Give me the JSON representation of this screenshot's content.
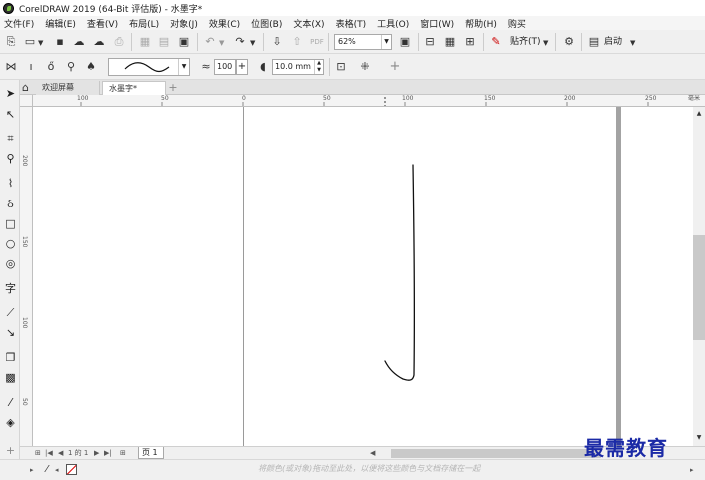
{
  "window": {
    "title": "CorelDRAW 2019 (64-Bit 评估版) - 水墨字*"
  },
  "menu": [
    "文件(F)",
    "编辑(E)",
    "查看(V)",
    "布局(L)",
    "对象(J)",
    "效果(C)",
    "位图(B)",
    "文本(X)",
    "表格(T)",
    "工具(O)",
    "窗口(W)",
    "帮助(H)",
    "购买"
  ],
  "toolbar": {
    "zoom_value": "62%",
    "snap_label": "贴齐(T)",
    "launch_label": "启动",
    "smoothing_value": "100",
    "width_value": "10.0 mm"
  },
  "tabs": {
    "welcome": "欢迎屏幕",
    "document": "水墨字*"
  },
  "ruler": {
    "top_labels": [
      "100",
      "50",
      "0",
      "50",
      "100",
      "150",
      "200",
      "250"
    ],
    "top_unit": "毫米",
    "left_labels": [
      "200",
      "150",
      "100",
      "50"
    ]
  },
  "page_nav": {
    "counter": "1 的 1",
    "page_tab": "页 1"
  },
  "status": {
    "hint": "将颜色(或对象)拖动至此处，以便将这些颜色与文档存储在一起"
  },
  "watermark": "最需教育",
  "icons": {
    "title": "coreldraw-logo-icon",
    "new": "new-document-icon",
    "open": "open-icon",
    "save": "save-icon",
    "undo": "undo-icon",
    "redo": "redo-icon"
  },
  "colors": {
    "accent_green": "#7bc243",
    "watermark": "#1b2aa6",
    "no_fill_line": "#dd0000"
  }
}
